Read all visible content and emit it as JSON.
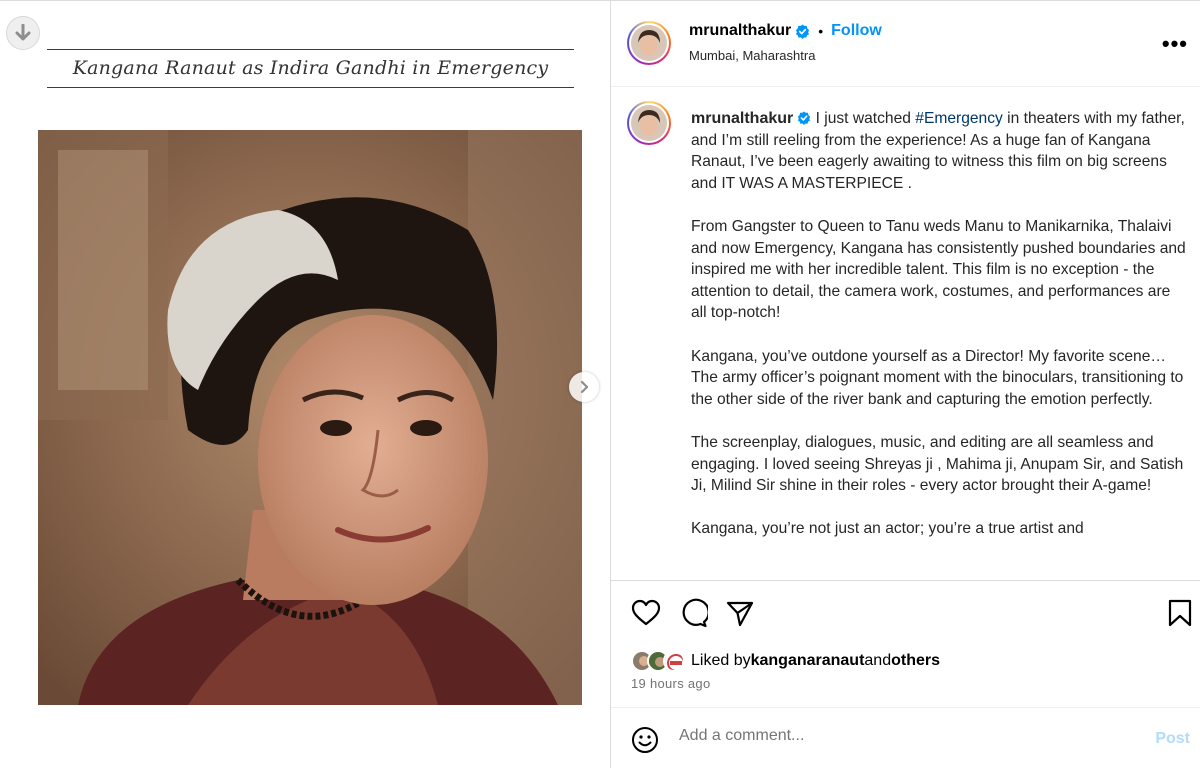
{
  "media": {
    "image_caption": "Kangana Ranaut as Indira Gandhi in Emergency"
  },
  "header": {
    "username": "mrunalthakur",
    "dot": "•",
    "follow_label": "Follow",
    "location": "Mumbai, Maharashtra",
    "more_label": "•••"
  },
  "post": {
    "author": "mrunalthakur",
    "intro_before_tag": " I just watched ",
    "hashtag": "#Emergency",
    "intro_after_tag": " in theaters with my father, and I’m still reeling from the experience! As a huge fan of Kangana Ranaut, I’ve been eagerly awaiting to witness this film on big screens and IT WAS A MASTERPIECE .",
    "para2": "From Gangster to Queen to Tanu weds Manu to Manikarnika, Thalaivi and now Emergency, Kangana has consistently pushed boundaries and inspired me with her incredible talent. This film is no exception - the attention to detail, the camera work, costumes, and performances are all top-notch!",
    "para3": "Kangana, you’ve outdone yourself as a Director! My favorite scene…The army officer’s poignant moment with the binoculars, transitioning to the other side of the river bank and capturing the emotion perfectly.",
    "para4": "The screenplay, dialogues, music, and editing are all seamless and engaging. I loved seeing Shreyas ji , Mahima ji, Anupam Sir, and Satish Ji, Milind Sir shine in their roles - every actor brought their A-game!",
    "para5": "Kangana, you’re not just an actor; you’re a true artist and"
  },
  "likes": {
    "prefix": "Liked by ",
    "user": "kanganaranaut",
    "middle": " and ",
    "others": "others"
  },
  "timestamp": "19 hours ago",
  "comment": {
    "placeholder": "Add a comment...",
    "post_label": "Post"
  },
  "colors": {
    "accent": "#0095f6",
    "hashtag": "#00376b",
    "post_disabled": "#b3dbff"
  }
}
